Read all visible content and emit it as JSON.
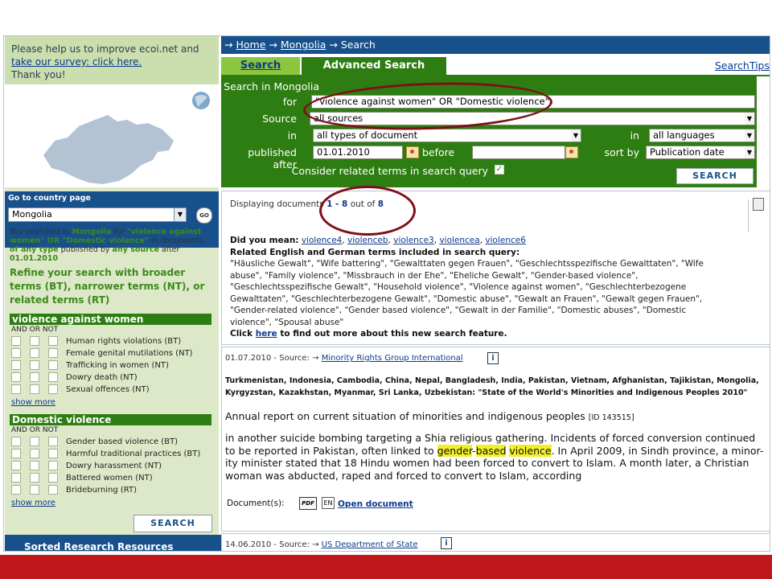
{
  "survey": {
    "line1": "Please help us to improve ecoi.net and",
    "link": "take our survey: click here.",
    "thanks": "Thank you!"
  },
  "country": {
    "label": "Go to country page",
    "selected": "Mongolia",
    "go": "GO"
  },
  "searched": {
    "p1": "You searched in ",
    "country": "Mongolia",
    "p2": " for ",
    "query": "\"violence against women\" OR \"Domestic violence\"",
    "p3": " in documents ",
    "p4": "of any type",
    "p5": " published by ",
    "p6": "any source",
    "p7": " after ",
    "date": "01.01.2010"
  },
  "refine": "Refine your search with broader terms (BT), narrower terms (NT), or related terms (RT)",
  "facets": [
    {
      "title": "violence against women",
      "andor": "AND OR NOT",
      "items": [
        "Human rights violations (BT)",
        "Female genital mutilations (NT)",
        "Trafficking in women (NT)",
        "Dowry death (NT)",
        "Sexual offences (NT)"
      ],
      "more": "show more"
    },
    {
      "title": "Domestic violence",
      "andor": "AND OR NOT",
      "items": [
        "Gender based violence (BT)",
        "Harmful traditional practices (BT)",
        "Dowry harassment (NT)",
        "Battered women (NT)",
        "Brideburning (RT)"
      ],
      "more": "show more"
    }
  ],
  "left_search": "SEARCH",
  "sorted": "Sorted Research Resources",
  "breadcrumb": {
    "home": "Home",
    "country": "Mongolia",
    "current": "Search",
    "sep": "→"
  },
  "tabs": {
    "search": "Search",
    "advanced": "Advanced Search",
    "tips": "SearchTips"
  },
  "form": {
    "search_in": "Search in Mongolia",
    "for": "for",
    "for_value": "\"violence against women\" OR \"Domestic violence\"",
    "source": "Source",
    "source_value": "all sources",
    "in": "in",
    "type_value": "all types of document",
    "in2": "in",
    "lang_value": "all languages",
    "published_after": "published after",
    "after_value": "01.01.2010",
    "before": "before",
    "before_value": "",
    "sort_by": "sort by",
    "sort_value": "Publication date",
    "related": "Consider related terms in search query",
    "button": "SEARCH"
  },
  "results": {
    "displaying": "Displaying documents ",
    "range": "1 - 8",
    "outof": " out of ",
    "total": "8",
    "didmean": "Did you mean:",
    "suggestions": [
      "violence4",
      "violenceb",
      "violence3",
      "violencea",
      "violence6"
    ],
    "related_title": "Related English and German terms included in search query:",
    "related_terms": "\"Häusliche Gewalt\", \"Wife battering\", \"Gewalttaten gegen Frauen\", \"Geschlechtsspezifische Gewalttaten\", \"Wife abuse\", \"Family violence\", \"Missbrauch in der Ehe\", \"Eheliche Gewalt\", \"Gender-based violence\", \"Geschlechtsspezifische Gewalt\", \"Household violence\", \"Violence against women\", \"Geschlechterbezogene Gewalttaten\", \"Geschlechterbezogene Gewalt\", \"Domestic abuse\", \"Gewalt an Frauen\", \"Gewalt gegen Frauen\", \"Gender-related violence\", \"Gender based violence\", \"Gewalt in der Familie\", \"Domestic abuses\", \"Domestic violence\", \"Spousal abuse\"",
    "click": "Click ",
    "here": "here",
    "click_rest": " to find out more about this new search feature."
  },
  "doc1": {
    "date": "01.07.2010 - Source: ",
    "source": "Minority Rights Group International",
    "countries": "Turkmenistan, Indonesia, Cambodia, China, Nepal, Bangladesh, India, Pakistan, Vietnam, Afghanistan, Tajikistan, Mongolia, Kyrgyzstan, Kazakhstan, Myanmar, Sri Lanka, Uzbekistan: \"State of the World's Minorities and Indigenous Peoples 2010\"",
    "summary": "Annual report on current situation of minorities and indigenous peoples ",
    "id": "[ID 143515]",
    "ex1": "in another suicide bombing targeting a Shia religious gathering. Incidents of forced conversion continued to be reported in Pakistan, often linked to ",
    "hl1": "gender",
    "dash": "-",
    "hl2": "based",
    "sp": " ",
    "hl3": "violence",
    "ex2": ". In April 2009, in Sindh province, a minor- ity minister stated that 18 Hindu women had been forced to convert to Islam. A month later, a Christian woman was abducted, raped and forced to convert to Islam, according",
    "documents": "Document(s):",
    "pdf": "PDF",
    "en": "EN",
    "open": "Open document"
  },
  "doc2": {
    "date": "14.06.2010 - Source: ",
    "source": "US Department of State"
  },
  "colors": {
    "navy": "#17508a",
    "green": "#2e7d13",
    "lightgreen": "#8cc63f",
    "highlight": "#f2ef2a",
    "annotation": "#7d1016",
    "bar": "#c0171b"
  }
}
